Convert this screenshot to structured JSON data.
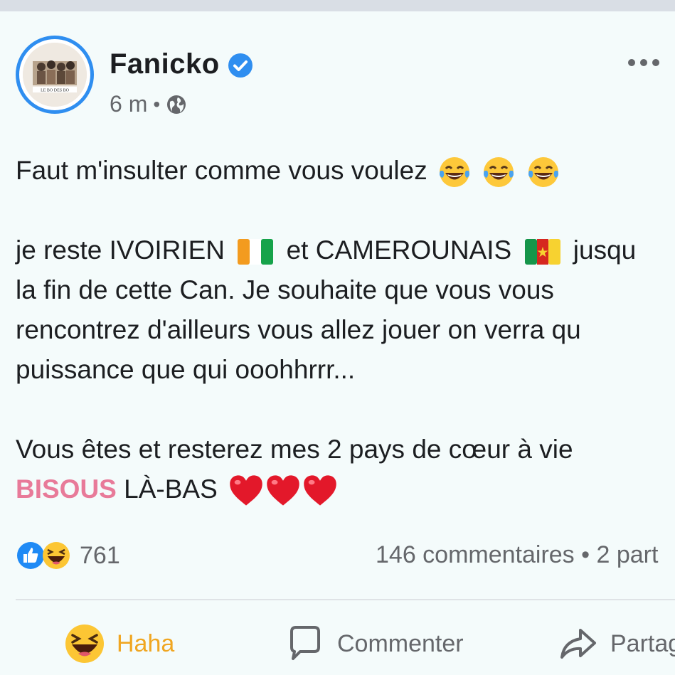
{
  "post": {
    "author": "Fanicko",
    "verified": true,
    "time": "6 m",
    "separator": "•",
    "audience_icon": "globe-icon",
    "menu_icon": "more-dots-icon",
    "avatar_text": "LE BO DES BO",
    "line1": "Faut m'insulter comme vous voulez",
    "line2_a": "je reste IVOIRIEN",
    "line2_b": "et CAMEROUNAIS",
    "line2_c": "jusqu",
    "line3": "la fin de cette Can. Je souhaite que vous vous",
    "line4": "rencontrez d'ailleurs vous allez jouer on verra qu",
    "line5": "puissance que qui ooohhrrr...",
    "line6": "Vous êtes et resterez mes 2 pays de cœur à vie",
    "line7_pink": "BISOUS",
    "line7_rest": "LÀ-BAS"
  },
  "stats": {
    "reaction_count": "761",
    "comments_shares": "146 commentaires • 2 part"
  },
  "actions": {
    "haha_label": "Haha",
    "comment_label": "Commenter",
    "share_label": "Partag"
  },
  "colors": {
    "accent": "#2f8ef0",
    "bisous_pink": "#e87a99",
    "haha_yellow": "#f0a621",
    "secondary_text": "#65676b"
  }
}
